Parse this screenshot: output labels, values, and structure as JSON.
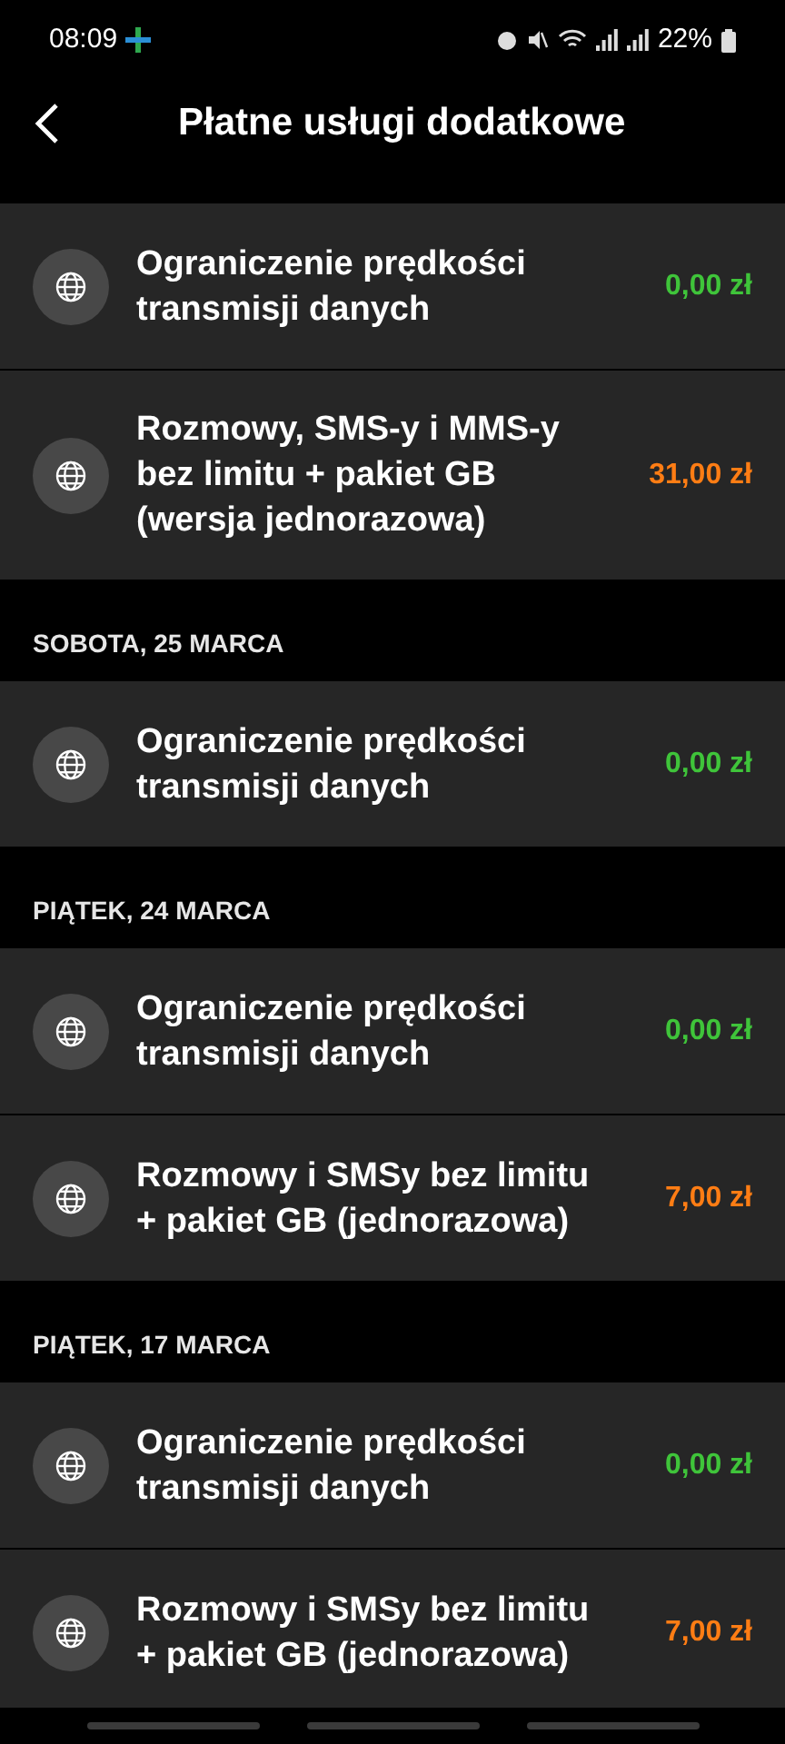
{
  "status_bar": {
    "time": "08:09",
    "battery": "22%"
  },
  "header": {
    "title": "Płatne usługi dodatkowe"
  },
  "groups": [
    {
      "items": [
        {
          "name": "Ograniczenie prędkości transmisji danych",
          "price": "0,00 zł",
          "color": "#3fc43a"
        },
        {
          "name": "Rozmowy, SMS-y i MMS-y bez limitu + pakiet GB (wersja jednorazowa)",
          "price": "31,00 zł",
          "color": "#ff7d14"
        }
      ]
    },
    {
      "date": "SOBOTA, 25 MARCA",
      "items": [
        {
          "name": "Ograniczenie prędkości transmisji danych",
          "price": "0,00 zł",
          "color": "#3fc43a"
        }
      ]
    },
    {
      "date": "PIĄTEK, 24 MARCA",
      "items": [
        {
          "name": "Ograniczenie prędkości transmisji danych",
          "price": "0,00 zł",
          "color": "#3fc43a"
        },
        {
          "name": "Rozmowy i SMSy bez limitu + pakiet GB (jednorazowa)",
          "price": "7,00 zł",
          "color": "#ff7d14"
        }
      ]
    },
    {
      "date": "PIĄTEK, 17 MARCA",
      "items": [
        {
          "name": "Ograniczenie prędkości transmisji danych",
          "price": "0,00 zł",
          "color": "#3fc43a"
        },
        {
          "name": "Rozmowy i SMSy bez limitu + pakiet GB (jednorazowa)",
          "price": "7,00 zł",
          "color": "#ff7d14"
        }
      ]
    }
  ]
}
